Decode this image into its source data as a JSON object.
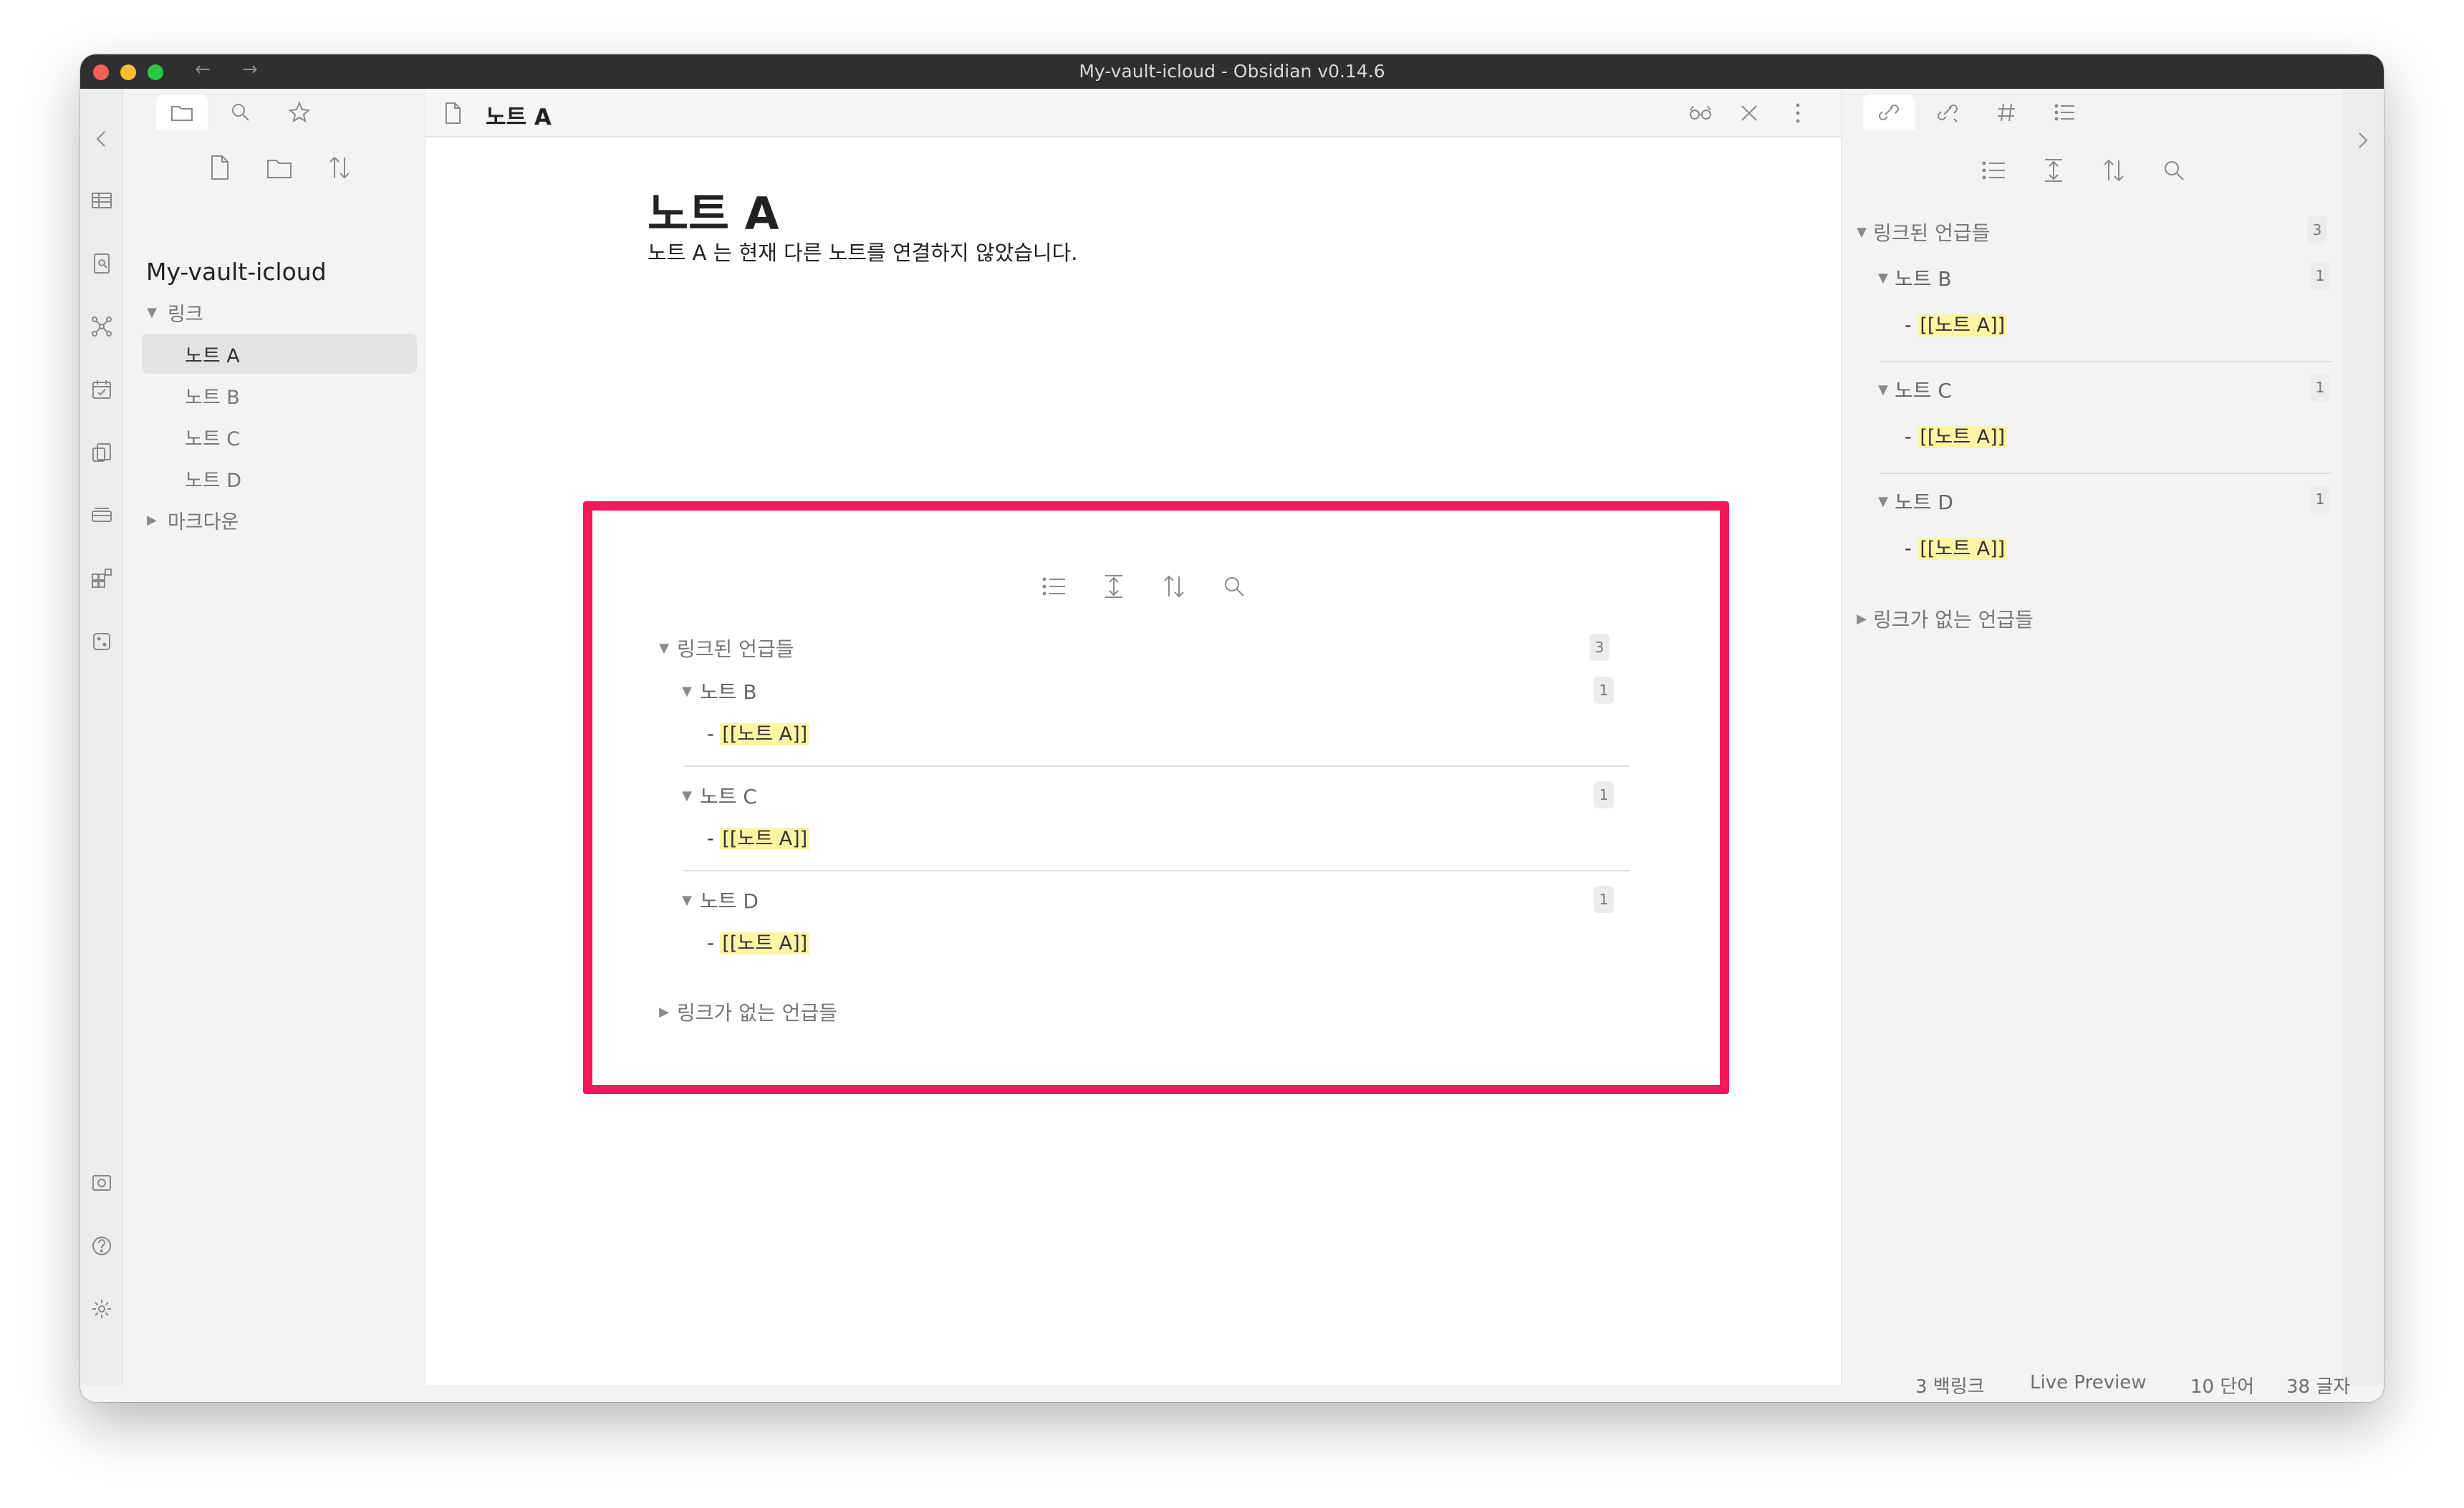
{
  "window": {
    "title": "My-vault-icloud - Obsidian v0.14.6",
    "back_label": "←",
    "forward_label": "→"
  },
  "ribbon": {
    "icons": [
      "table-icon",
      "document-search-icon",
      "graph-icon",
      "calendar-icon",
      "copy-icon",
      "kanban-icon",
      "plugin-grid-icon",
      "dice-icon"
    ],
    "bottom_icons": [
      "vault-icon",
      "help-icon",
      "settings-icon"
    ]
  },
  "left_panel": {
    "vault_name": "My-vault-icloud",
    "tree": [
      {
        "label": "링크",
        "type": "folder",
        "expanded": true
      },
      {
        "label": "노트 A",
        "type": "file",
        "selected": true
      },
      {
        "label": "노트 B",
        "type": "file"
      },
      {
        "label": "노트 C",
        "type": "file"
      },
      {
        "label": "노트 D",
        "type": "file"
      },
      {
        "label": "마크다운",
        "type": "folder",
        "expanded": false
      }
    ]
  },
  "editor": {
    "tab_title": "노트 A",
    "note_title": "노트 A",
    "body": "노트 A 는 현재 다른 노트를 연결하지 않았습니다."
  },
  "backlinks": {
    "linked_header": "링크된 언급들",
    "linked_count": "3",
    "groups": [
      {
        "note": "노트 B",
        "count": "1",
        "dash": "-",
        "link": "[[노트 A]]"
      },
      {
        "note": "노트 C",
        "count": "1",
        "dash": "-",
        "link": "[[노트 A]]"
      },
      {
        "note": "노트 D",
        "count": "1",
        "dash": "-",
        "link": "[[노트 A]]"
      }
    ],
    "unlinked_header": "링크가 없는 언급들"
  },
  "status": {
    "backlinks": "3 백링크",
    "mode": "Live Preview",
    "words": "10 단어",
    "chars": "38 글자"
  },
  "colors": {
    "accent_highlight": "#f2185a",
    "link_highlight": "#fbf5a4"
  }
}
